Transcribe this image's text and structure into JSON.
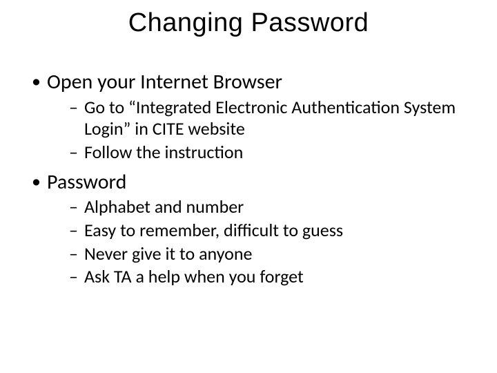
{
  "title": "Changing Password",
  "bullets": [
    {
      "text": "Open your Internet Browser",
      "sub": [
        "Go to “Integrated Electronic Authentication System Login” in CITE website",
        "Follow the instruction"
      ]
    },
    {
      "text": "Password",
      "sub": [
        "Alphabet and number",
        "Easy to remember, difficult to guess",
        "Never give it to anyone",
        "Ask TA a help when you forget"
      ]
    }
  ]
}
